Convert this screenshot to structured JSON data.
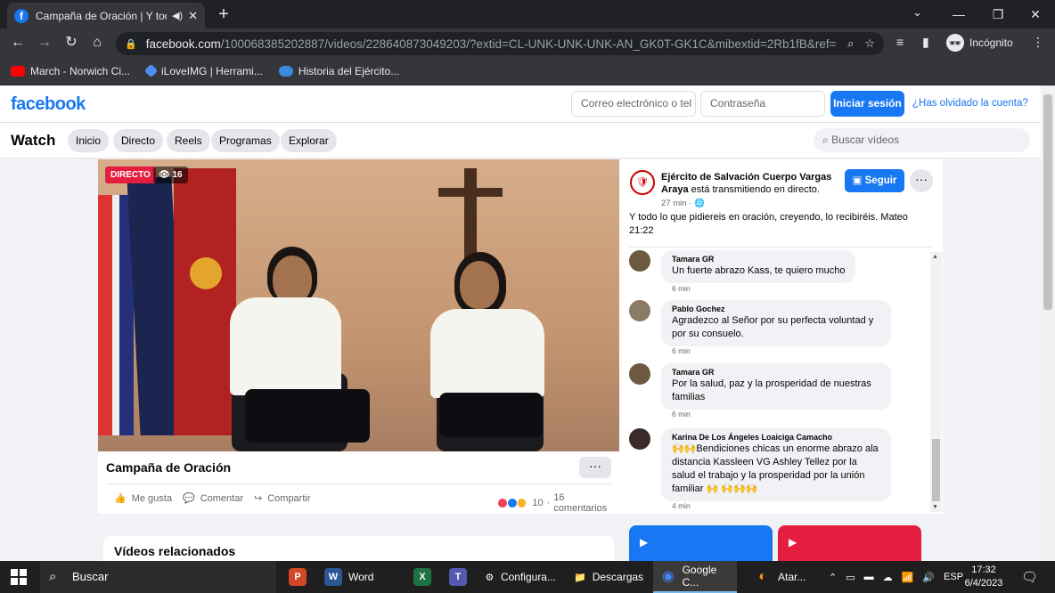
{
  "browser": {
    "tab_title": "Campaña de Oración | Y todo",
    "tab_favicon": "f",
    "url_main": "facebook.com",
    "url_rest": "/100068385202887/videos/228640873049203/?extid=CL-UNK-UNK-UNK-AN_GK0T-GK1C&mibextid=2Rb1fB&ref=sha...",
    "incognito_label": "Incógnito",
    "bookmarks": [
      {
        "label": "March - Norwich Ci...",
        "color": "#ff0000"
      },
      {
        "label": "iLoveIMG | Herrami...",
        "color": "#4f8df5"
      },
      {
        "label": "Historia del Ejército...",
        "color": "#3d8be0"
      }
    ]
  },
  "fb_header": {
    "logo": "facebook",
    "email_placeholder": "Correo electrónico o tel",
    "password_placeholder": "Contraseña",
    "login_label": "Iniciar sesión",
    "forgot_label": "¿Has olvidado la cuenta?"
  },
  "watch": {
    "title": "Watch",
    "nav": [
      "Inicio",
      "Directo",
      "Reels",
      "Programas",
      "Explorar"
    ],
    "search_placeholder": "Buscar vídeos"
  },
  "video": {
    "live_label": "DIRECTO",
    "viewers": "16",
    "title": "Campaña de Oración",
    "more_label": "···",
    "like_label": "Me gusta",
    "comment_label": "Comentar",
    "share_label": "Compartir",
    "reaction_count": "10",
    "comments_count": "16 comentarios"
  },
  "post": {
    "author": "Ejército de Salvación Cuerpo Vargas Araya",
    "author_suffix": " está transmitiendo en directo.",
    "time": "27 min · ",
    "follow_label": "Seguir",
    "more_label": "···",
    "text": "Y todo lo que pidiereis en oración, creyendo, lo recibiréis. Mateo 21:22"
  },
  "comments": [
    {
      "name": "Tamara GR",
      "text": "Un fuerte abrazo Kass, te quiero mucho",
      "time": "6 min"
    },
    {
      "name": "Pablo Gochez",
      "text": "Agradezco al Señor por su perfecta voluntad y por su consuelo.",
      "time": "6 min"
    },
    {
      "name": "Tamara GR",
      "text": "Por la salud, paz y la prosperidad de nuestras familias",
      "time": "6 min"
    },
    {
      "name": "Karina De Los Ángeles Loaiciga Camacho",
      "text": "🙌🙌Bendiciones chicas un enorme abrazo ala distancia Kassleen VG Ashley Tellez por la salud el trabajo y la prosperidad por la unión familiar 🙌 🙌🙌🙌",
      "time": "4 min"
    }
  ],
  "related_title": "Vídeos relacionados",
  "taskbar": {
    "search_label": "Buscar",
    "apps": [
      {
        "label": "",
        "icon": "P",
        "color": "#d24726"
      },
      {
        "label": "Word",
        "icon": "W",
        "color": "#2b5797"
      },
      {
        "label": "",
        "icon": "X",
        "color": "#1e7145"
      },
      {
        "label": "",
        "icon": "T",
        "color": "#5558af"
      },
      {
        "label": "Configura...",
        "icon": "⚙",
        "color": "#1f1f1f"
      },
      {
        "label": "Descargas",
        "icon": "📁",
        "color": "#1f1f1f"
      },
      {
        "label": "Google C...",
        "icon": "◉",
        "color": "#1f1f1f"
      },
      {
        "label": "Atar...",
        "icon": "◐",
        "color": "#1f1f1f"
      }
    ],
    "lang": "ESP",
    "time": "17:32",
    "date": "6/4/2023"
  }
}
